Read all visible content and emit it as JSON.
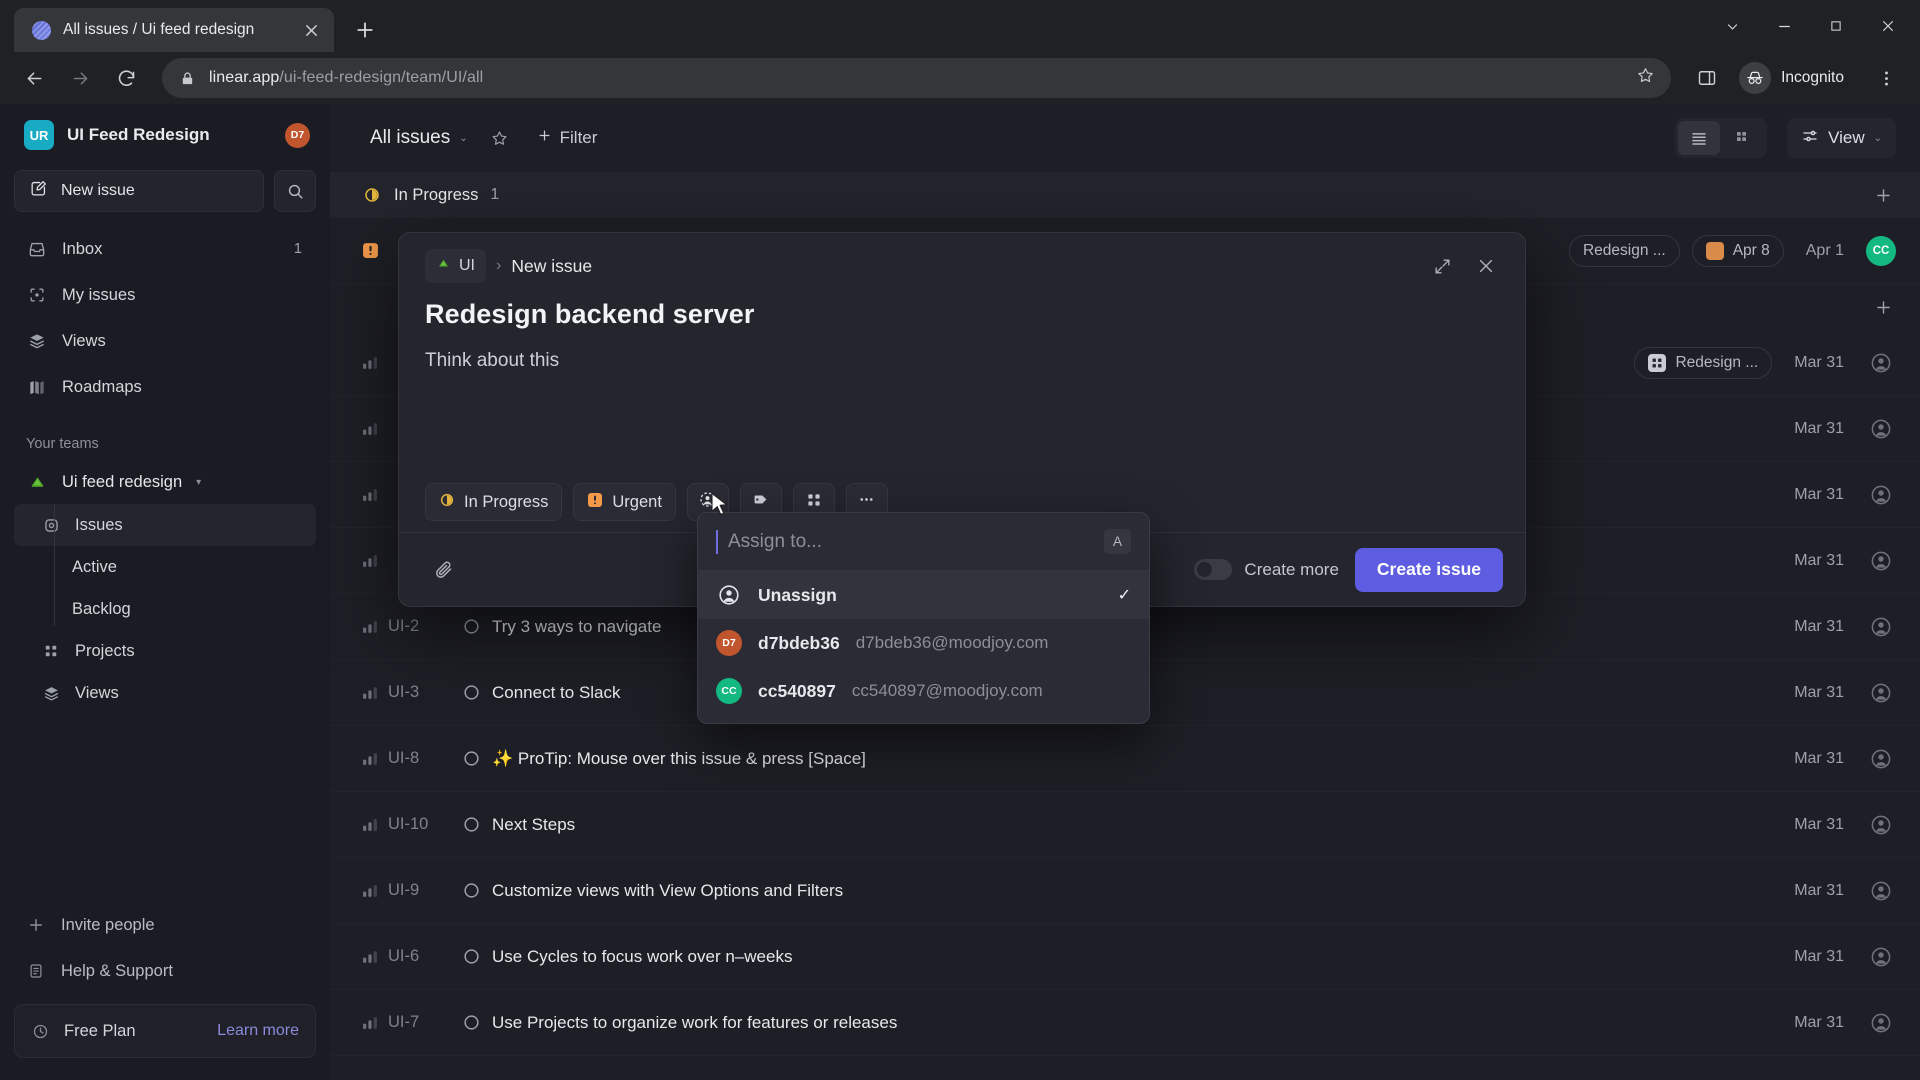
{
  "browser": {
    "tab": {
      "title": "All issues / Ui feed redesign",
      "favicon": "linear-logo-icon",
      "close": "×"
    },
    "newtab_label": "+",
    "window_controls": {
      "minimize_all": "⌄",
      "minimize": "−",
      "maximize": "▢",
      "close": "✕"
    },
    "url": {
      "domain": "linear.app",
      "path": "/ui-feed-redesign/team/UI/all"
    },
    "profile_label": "Incognito"
  },
  "sidebar": {
    "workspace": {
      "initials": "UR",
      "name": "UI Feed Redesign",
      "avatar_initials": "D7"
    },
    "new_issue_label": "New issue",
    "nav": [
      {
        "label": "Inbox",
        "icon": "inbox-icon",
        "badge": "1"
      },
      {
        "label": "My issues",
        "icon": "my-issues-icon",
        "badge": ""
      },
      {
        "label": "Views",
        "icon": "views-icon",
        "badge": ""
      },
      {
        "label": "Roadmaps",
        "icon": "roadmaps-icon",
        "badge": ""
      }
    ],
    "teams_label": "Your teams",
    "team": {
      "name": "Ui feed redesign",
      "caret": "▾"
    },
    "team_nav": [
      {
        "label": "Issues",
        "icon": "issues-icon",
        "active": true
      },
      {
        "label": "Active",
        "icon": "",
        "deep": true
      },
      {
        "label": "Backlog",
        "icon": "",
        "deep": true
      },
      {
        "label": "Projects",
        "icon": "projects-icon"
      },
      {
        "label": "Views",
        "icon": "views-icon"
      }
    ],
    "footer": [
      {
        "label": "Invite people",
        "icon": "plus-icon"
      },
      {
        "label": "Help & Support",
        "icon": "help-icon"
      }
    ],
    "plan": {
      "name": "Free Plan",
      "link": "Learn more"
    }
  },
  "main": {
    "view_title": "All issues",
    "view_caret": "⌄",
    "filter_label": "Filter",
    "view_button_label": "View",
    "view_button_caret": "⌄",
    "group": {
      "name": "In Progress",
      "count": "1",
      "plus": "+"
    },
    "second_group_plus": "+",
    "rows": [
      {
        "id": "",
        "title": "",
        "priority": "urgent",
        "project": "Redesign ...",
        "project_icon": "calendar-icon",
        "date": "Apr 8",
        "date2": "Apr 1",
        "avatar": "CC",
        "hidden_title": true
      },
      {
        "id": "",
        "title": "",
        "priority": "none",
        "project": "Redesign ...",
        "project_icon": "grid-icon",
        "date": "Mar 31",
        "avatar": ""
      },
      {
        "id": "",
        "title": "",
        "priority": "none",
        "project": "",
        "date": "Mar 31",
        "avatar": ""
      },
      {
        "id": "",
        "title": "",
        "priority": "none",
        "project": "",
        "date": "Mar 31",
        "avatar": ""
      },
      {
        "id": "",
        "title": "",
        "priority": "none",
        "project": "",
        "date": "Mar 31",
        "avatar": ""
      },
      {
        "id": "UI-2",
        "title": "Try 3 ways to navigate",
        "priority": "none",
        "project": "",
        "date": "Mar 31",
        "avatar": ""
      },
      {
        "id": "UI-3",
        "title": "Connect to Slack",
        "priority": "none",
        "project": "",
        "date": "Mar 31",
        "avatar": ""
      },
      {
        "id": "UI-8",
        "title": "✨ ProTip: Mouse over this issue & press [Space]",
        "priority": "none",
        "project": "",
        "date": "Mar 31",
        "avatar": ""
      },
      {
        "id": "UI-10",
        "title": "Next Steps",
        "priority": "none",
        "project": "",
        "date": "Mar 31",
        "avatar": ""
      },
      {
        "id": "UI-9",
        "title": "Customize views with View Options and Filters",
        "priority": "none",
        "project": "",
        "date": "Mar 31",
        "avatar": ""
      },
      {
        "id": "UI-6",
        "title": "Use Cycles to focus work over n–weeks",
        "priority": "none",
        "project": "",
        "date": "Mar 31",
        "avatar": ""
      },
      {
        "id": "UI-7",
        "title": "Use Projects to organize work for features or releases",
        "priority": "none",
        "project": "",
        "date": "Mar 31",
        "avatar": ""
      }
    ]
  },
  "modal": {
    "crumb_team": "UI",
    "crumb_sep": "›",
    "crumb_leaf": "New issue",
    "expand_icon": "expand-icon",
    "close_icon": "close-icon",
    "title": "Redesign backend server",
    "description": "Think about this",
    "props": {
      "status": "In Progress",
      "priority": "Urgent",
      "assignee_icon": "assignee-icon",
      "label_icon": "label-icon",
      "project_icon": "project-icon",
      "more_icon": "more-icon"
    },
    "attach_icon": "attachment-icon",
    "create_more_label": "Create more",
    "create_button_label": "Create issue"
  },
  "assignee_dropdown": {
    "placeholder": "Assign to...",
    "hint_key": "A",
    "items": [
      {
        "name": "Unassign",
        "email": "",
        "initials": "",
        "color": "",
        "selected": true,
        "check": "✓"
      },
      {
        "name": "d7bdeb36",
        "email": "d7bdeb36@moodjoy.com",
        "initials": "D7",
        "color": "#c1562e",
        "selected": false,
        "check": ""
      },
      {
        "name": "cc540897",
        "email": "cc540897@moodjoy.com",
        "initials": "CC",
        "color": "#13b981",
        "selected": false,
        "check": ""
      }
    ]
  }
}
